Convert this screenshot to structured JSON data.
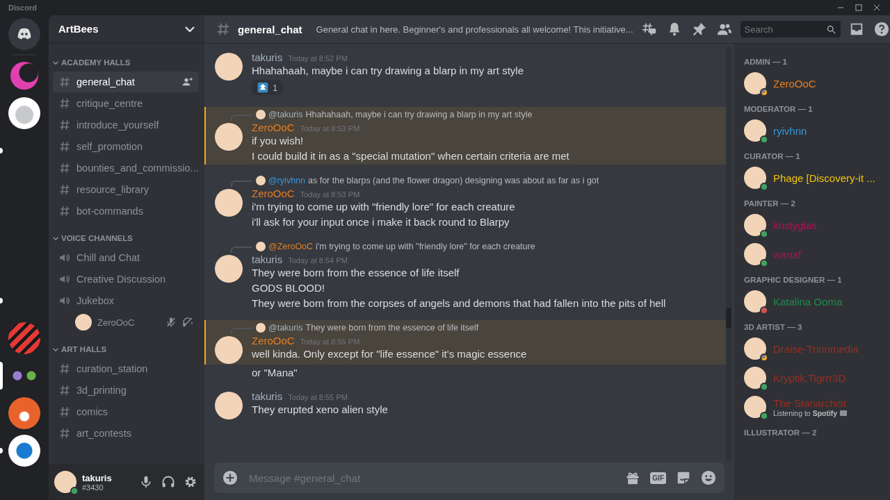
{
  "window": {
    "title": "Discord"
  },
  "servers": [
    {
      "kind": "home",
      "selected": false,
      "unread": false
    },
    {
      "kind": "moon",
      "selected": false,
      "unread": false
    },
    {
      "kind": "kettle",
      "selected": false,
      "unread": false
    },
    {
      "kind": "empty",
      "selected": false,
      "unread": true
    },
    {
      "kind": "empty",
      "selected": false,
      "unread": false
    },
    {
      "kind": "empty",
      "selected": false,
      "unread": false
    },
    {
      "kind": "empty",
      "selected": false,
      "unread": false
    },
    {
      "kind": "empty",
      "selected": false,
      "unread": true
    },
    {
      "kind": "dcd",
      "selected": false,
      "unread": false
    },
    {
      "kind": "flowers",
      "selected": true,
      "unread": false
    },
    {
      "kind": "fox",
      "selected": false,
      "unread": false
    },
    {
      "kind": "cube",
      "selected": false,
      "unread": true
    }
  ],
  "server_name": "ArtBees",
  "categories": [
    {
      "name": "ACADEMY HALLS",
      "expanded": true,
      "channels": [
        {
          "kind": "text",
          "name": "general_chat",
          "selected": true
        },
        {
          "kind": "text",
          "name": "critique_centre",
          "selected": false
        },
        {
          "kind": "text",
          "name": "introduce_yourself",
          "selected": false
        },
        {
          "kind": "text",
          "name": "self_promotion",
          "selected": false
        },
        {
          "kind": "text",
          "name": "bounties_and_commissio...",
          "selected": false
        },
        {
          "kind": "text",
          "name": "resource_library",
          "selected": false
        },
        {
          "kind": "text",
          "name": "bot-commands",
          "selected": false
        }
      ]
    },
    {
      "name": "VOICE CHANNELS",
      "expanded": true,
      "channels": [
        {
          "kind": "voice",
          "name": "Chill and Chat",
          "selected": false
        },
        {
          "kind": "voice",
          "name": "Creative Discussion",
          "selected": false
        },
        {
          "kind": "voice",
          "name": "Jukebox",
          "selected": false,
          "users": [
            {
              "name": "ZeroOoC",
              "muted": true,
              "deafened": true
            }
          ]
        }
      ]
    },
    {
      "name": "ART HALLS",
      "expanded": true,
      "channels": [
        {
          "kind": "text",
          "name": "curation_station",
          "selected": false
        },
        {
          "kind": "text",
          "name": "3d_printing",
          "selected": false
        },
        {
          "kind": "text",
          "name": "comics",
          "selected": false
        },
        {
          "kind": "text",
          "name": "art_contests",
          "selected": false
        }
      ]
    }
  ],
  "user_panel": {
    "name": "takuris",
    "tag": "#3430",
    "online": true,
    "idle": false,
    "dnd": false
  },
  "header": {
    "channel": "general_chat",
    "topic": "General chat in here. Beginner's and professionals all welcome! This initiative...",
    "search": {
      "placeholder": "Search"
    }
  },
  "messages": [
    {
      "author": "takuris",
      "color": "#a3b1bd",
      "time": "Today at 8:52 PM",
      "highlighted": false,
      "lines": [
        "Hhahahaah, maybe i can try drawing a blarp in my art style"
      ],
      "reaction": {
        "count": "1"
      }
    },
    {
      "reply": {
        "author": "@takuris",
        "color": "#a3b1bd",
        "text": "Hhahahaah, maybe i can try drawing a blarp in my art style"
      },
      "author": "ZeroOoC",
      "color": "#e67e22",
      "time": "Today at 8:53 PM",
      "highlighted": true,
      "lines": [
        "if you wish!",
        "I could build it in as a \"special mutation\" when certain criteria are met"
      ]
    },
    {
      "reply": {
        "author": "@ryivhnn",
        "color": "#3498db",
        "text": "as for the blarps (and the flower dragon) designing was about as far as i got"
      },
      "author": "ZeroOoC",
      "color": "#e67e22",
      "time": "Today at 8:53 PM",
      "highlighted": false,
      "lines": [
        "i'm trying to come up with \"friendly lore\" for each creature",
        "i'll ask for your input once i make it back round to Blarpy"
      ]
    },
    {
      "reply": {
        "author": "@ZeroOoC",
        "color": "#e67e22",
        "text": "i'm trying to come up with \"friendly lore\" for each creature"
      },
      "author": "takuris",
      "color": "#a3b1bd",
      "time": "Today at 8:54 PM",
      "highlighted": false,
      "lines": [
        "They were born from the essence of life itself",
        "GODS BLOOD!",
        "They were born from the corpses of angels and demons that had fallen into the pits of hell"
      ]
    },
    {
      "reply": {
        "author": "@takuris",
        "color": "#a3b1bd",
        "text": "They were born from the essence of life itself"
      },
      "author": "ZeroOoC",
      "color": "#e67e22",
      "time": "Today at 8:55 PM",
      "highlighted": true,
      "lines": [
        "well kinda. Only except for \"life essence\" it's magic essence"
      ]
    },
    {
      "highlighted": false,
      "lines": [
        "or \"Mana\""
      ]
    },
    {
      "author": "takuris",
      "color": "#a3b1bd",
      "time": "Today at 8:55 PM",
      "highlighted": false,
      "lines": [
        "They erupted xeno alien style"
      ]
    }
  ],
  "composer": {
    "placeholder": "Message #general_chat",
    "gif_label": "GIF"
  },
  "member_groups": [
    {
      "role": "ADMIN — 1",
      "members": [
        {
          "name": "ZeroOoC",
          "color": "#e67e22",
          "online": false,
          "idle": true,
          "dnd": false
        }
      ]
    },
    {
      "role": "MODERATOR — 1",
      "members": [
        {
          "name": "ryivhnn",
          "color": "#3498db",
          "online": true,
          "idle": false,
          "dnd": false
        }
      ]
    },
    {
      "role": "CURATOR — 1",
      "members": [
        {
          "name": "Phage [Discovery-it ...",
          "color": "#f1c40f",
          "online": true,
          "idle": false,
          "dnd": false
        }
      ]
    },
    {
      "role": "PAINTER — 2",
      "members": [
        {
          "name": "kristyglas",
          "color": "#ad1457",
          "online": true,
          "idle": false,
          "dnd": false
        },
        {
          "name": "wanaf",
          "color": "#ad1457",
          "online": true,
          "idle": false,
          "dnd": false
        }
      ]
    },
    {
      "role": "GRAPHIC DESIGNER — 1",
      "members": [
        {
          "name": "Katalina Ooma",
          "color": "#1f8b4c",
          "online": false,
          "idle": false,
          "dnd": true
        }
      ]
    },
    {
      "role": "3D ARTIST — 3",
      "members": [
        {
          "name": "Draise-Trinumedia",
          "color": "#992d22",
          "online": false,
          "idle": true,
          "dnd": false
        },
        {
          "name": "Kryptik.Tigrrr3D",
          "color": "#992d22",
          "online": true,
          "idle": false,
          "dnd": false
        },
        {
          "name": "The Stanarchist",
          "color": "#992d22",
          "online": true,
          "idle": false,
          "dnd": false,
          "activity": "Listening to **Spotify**"
        }
      ]
    },
    {
      "role": "ILLUSTRATOR — 2"
    }
  ]
}
